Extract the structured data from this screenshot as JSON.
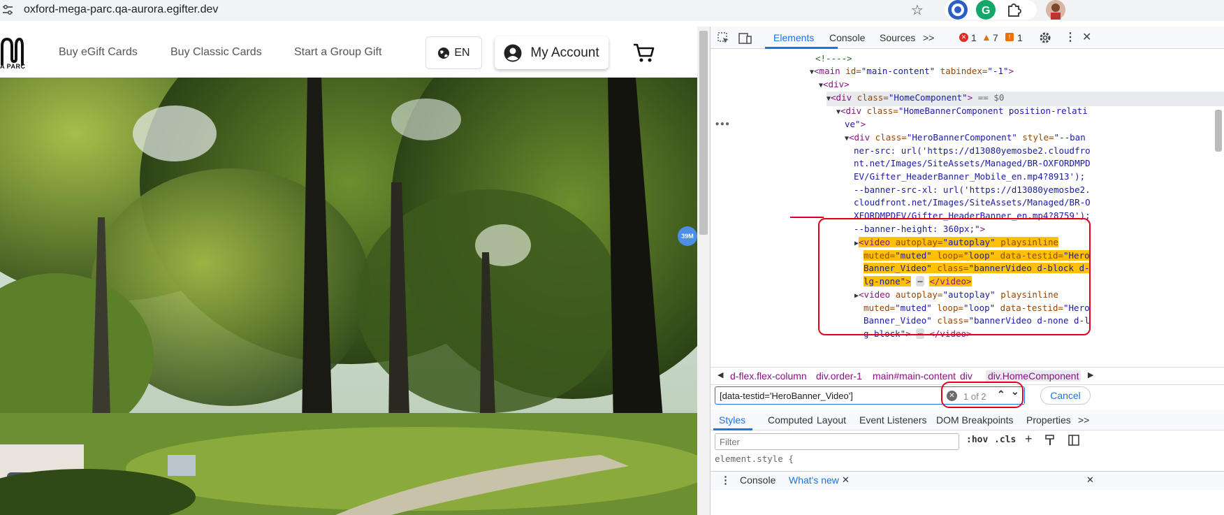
{
  "browser": {
    "url": "oxford-mega-parc.qa-aurora.egifter.dev"
  },
  "site": {
    "logo_text": "A PARC",
    "nav": [
      "Buy eGift Cards",
      "Buy Classic Cards",
      "Start a Group Gift"
    ],
    "language": "EN",
    "account": "My Account",
    "badge": "39M"
  },
  "devtools": {
    "tabs": [
      "Elements",
      "Console",
      "Sources",
      ">>"
    ],
    "errors": "1",
    "warnings": "7",
    "issues": "1",
    "dom": {
      "l1": "<!---->",
      "l2_tag": "<main",
      "l2_a1": " id=",
      "l2_v1": "\"main-content\"",
      "l2_a2": " tabindex=",
      "l2_v2": "\"-1\"",
      "l2_end": ">",
      "l3": "<div>",
      "l4_tag": "<div",
      "l4_a": " class=",
      "l4_v": "\"HomeComponent\"",
      "l4_end": ">",
      "l4_eq": " == $0",
      "l5a_tag": "<div",
      "l5a_a": " class=",
      "l5a_v": "\"HomeBannerComponent position-relati",
      "l5b_v": "ve\"",
      "l5b_end": ">",
      "l6a_tag": "<div",
      "l6a_a": " class=",
      "l6a_v": "\"HeroBannerComponent\"",
      "l6a_a2": " style=",
      "l6a_v2": "\"--ban",
      "l6b": "ner-src: url('https://d13080yemosbe2.cloudfro",
      "l6c": "nt.net/Images/SiteAssets/Managed/BR-OXFORDMPD",
      "l6d": "EV/Gifter_HeaderBanner_Mobile_en.mp4?8913');",
      "l6e": "--banner-src-xl: url('https://d13080yemosbe2.",
      "l6f": "cloudfront.net/Images/SiteAssets/Managed/BR-O",
      "l6g": "XFORDMPDEV/Gifter_HeaderBanner_en.mp4?8759');",
      "l6h": "--banner-height: 360px;\"",
      "l6h_end": ">",
      "v1a_tag": "<video",
      "v1a_a1": " autoplay=",
      "v1a_v1": "\"autoplay\"",
      "v1a_a2": " playsinline",
      "v1b_a1": "muted=",
      "v1b_v1": "\"muted\"",
      "v1b_a2": " loop=",
      "v1b_v2": "\"loop\"",
      "v1b_a3": " data-testid=",
      "v1b_v3": "\"Hero",
      "v1c_v3": "Banner_Video\"",
      "v1c_a4": " class=",
      "v1c_v4": "\"bannerVideo d-block d-",
      "v1d_v4": "lg-none\"",
      "v1d_end": ">",
      "v1d_close": "</video>",
      "v2a_tag": "<video",
      "v2a_a1": " autoplay=",
      "v2a_v1": "\"autoplay\"",
      "v2a_a2": " playsinline",
      "v2b_a1": "muted=",
      "v2b_v1": "\"muted\"",
      "v2b_a2": " loop=",
      "v2b_v2": "\"loop\"",
      "v2b_a3": " data-testid=",
      "v2b_v3": "\"Hero",
      "v2c_v3": "Banner_Video\"",
      "v2c_a4": " class=",
      "v2c_v4": "\"bannerVideo d-none d-l",
      "v2d_v4": "g-block\"",
      "v2d_end": ">",
      "v2d_close": "</video>"
    },
    "breadcrumbs": [
      "d-flex.flex-column",
      "div.order-1",
      "main#main-content",
      "div",
      "div.HomeComponent"
    ],
    "search_value": "[data-testid='HeroBanner_Video']",
    "search_count": "1 of 2",
    "cancel": "Cancel",
    "styles_tabs": [
      "Styles",
      "Computed",
      "Layout",
      "Event Listeners",
      "DOM Breakpoints",
      "Properties",
      ">>"
    ],
    "filter_placeholder": "Filter",
    "filter_tools": [
      ":hov",
      ".cls"
    ],
    "element_style": "element.style {",
    "drawer_tabs": [
      "Console",
      "What's new"
    ]
  }
}
